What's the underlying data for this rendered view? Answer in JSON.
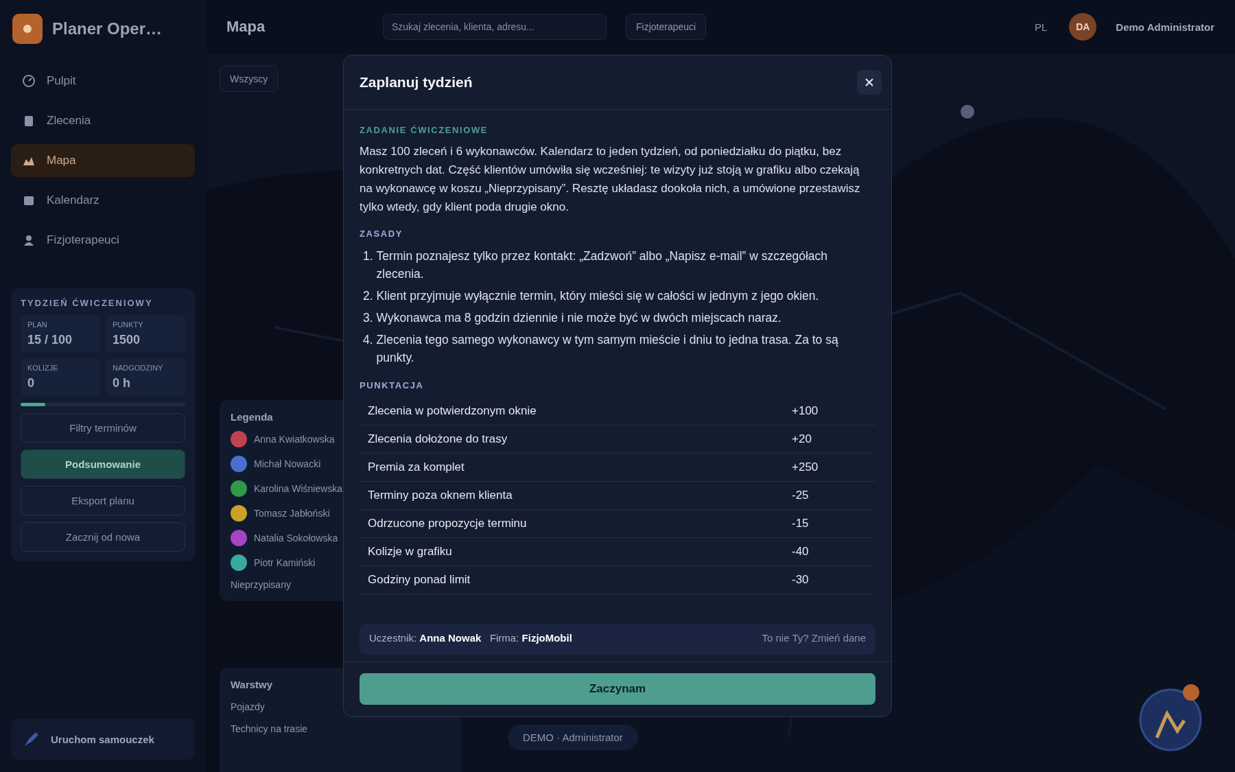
{
  "app": {
    "title": "Planer Oper…"
  },
  "sidebar": {
    "nav": [
      {
        "label": "Pulpit",
        "selected": false
      },
      {
        "label": "Zlecenia",
        "selected": false
      },
      {
        "label": "Mapa",
        "selected": true
      },
      {
        "label": "Kalendarz",
        "selected": false
      },
      {
        "label": "Fizjoterapeuci",
        "selected": false
      }
    ],
    "practice_panel": {
      "title": "TYDZIEŃ ĆWICZENIOWY",
      "stats": [
        {
          "label": "PLAN",
          "value": "15 / 100"
        },
        {
          "label": "PUNKTY",
          "value": "1500"
        },
        {
          "label": "KOLIZJE",
          "value": "0"
        },
        {
          "label": "NADGODZINY",
          "value": "0 h"
        }
      ],
      "level": 0.15,
      "filter_button": "Filtry terminów",
      "summary_button": "Podsumowanie",
      "export_button": "Eksport planu",
      "reset_button": "Zacznij od nowa"
    },
    "tutorial": {
      "title": "Uruchom samouczek"
    }
  },
  "topbar": {
    "page_title": "Mapa",
    "search": {
      "placeholder": "Szukaj zlecenia, klienta, adresu..."
    },
    "filter": "Fizjoterapeuci",
    "language": "PL",
    "user": {
      "name": "Demo Administrator",
      "initials": "DA"
    }
  },
  "map": {
    "filter": "Wszyscy",
    "legend": {
      "title": "Legenda",
      "employees": [
        {
          "name": "Anna Kwiatkowska",
          "color": "#c0444f"
        },
        {
          "name": "Michał Nowacki",
          "color": "#4a6fd0"
        },
        {
          "name": "Karolina Wiśniewska",
          "color": "#2f9a4a"
        },
        {
          "name": "Tomasz Jabłoński",
          "color": "#c9a227"
        },
        {
          "name": "Natalia Sokołowska",
          "color": "#a544c4"
        },
        {
          "name": "Piotr Kamiński",
          "color": "#3aa9a0"
        }
      ],
      "unassigned": "Nieprzypisany"
    },
    "layers": {
      "title": "Warstwy",
      "items": [
        "Pojazdy",
        "Technicy na trasie"
      ]
    },
    "mode_badge": "DEMO · Administrator"
  },
  "modal": {
    "title": "Zaplanuj tydzień",
    "task": {
      "heading": "ZADANIE ĆWICZENIOWE",
      "text": "Masz 100 zleceń i 6 wykonawców. Kalendarz to jeden tydzień, od poniedziałku do piątku, bez konkretnych dat. Część klientów umówiła się wcześniej: te wizyty już stoją w grafiku albo czekają na wykonawcę w koszu „Nieprzypisany”. Resztę układasz dookoła nich, a umówione przestawisz tylko wtedy, gdy klient poda drugie okno."
    },
    "rules": {
      "heading": "ZASADY",
      "items": [
        {
          "number": "1.",
          "text": "Termin poznajesz tylko przez kontakt: „Zadzwoń” albo „Napisz e-mail” w szczegółach zlecenia."
        },
        {
          "number": "2.",
          "text": "Klient przyjmuje wyłącznie termin, który mieści się w całości w jednym z jego okien."
        },
        {
          "number": "3.",
          "text": "Wykonawca ma 8 godzin dziennie i nie może być w dwóch miejscach naraz."
        },
        {
          "number": "4.",
          "text": "Zlecenia tego samego wykonawcy w tym samym mieście i dniu to jedna trasa. Za to są punkty."
        }
      ]
    },
    "scoring": {
      "heading": "PUNKTACJA",
      "rows": [
        {
          "label": "Zlecenia w potwierdzonym oknie",
          "points": "+100"
        },
        {
          "label": "Zlecenia dołożone do trasy",
          "points": "+20"
        },
        {
          "label": "Premia za komplet",
          "points": "+250"
        },
        {
          "label": "Terminy poza oknem klienta",
          "points": "-25"
        },
        {
          "label": "Odrzucone propozycje terminu",
          "points": "-15"
        },
        {
          "label": "Kolizje w grafiku",
          "points": "-40"
        },
        {
          "label": "Godziny ponad limit",
          "points": "-30"
        }
      ]
    },
    "participant": {
      "text": "Uczestnik: **Anna Nowak**   Firma: **FizjoMobil**",
      "link": "To nie Ty? Zmień dane"
    },
    "start_button": "Zaczynam"
  }
}
